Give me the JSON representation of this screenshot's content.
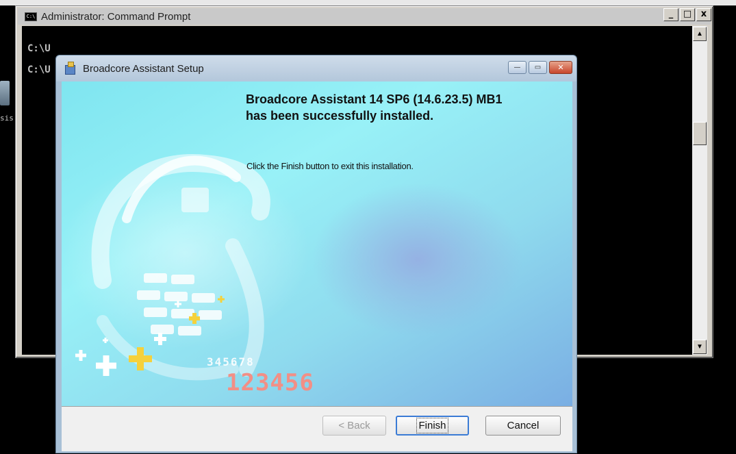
{
  "cmd_window": {
    "title": "Administrator: Command Prompt",
    "icon_text": "C:\\",
    "lines": [
      "C:\\U",
      "C:\\U"
    ],
    "controls": {
      "minimize": "_",
      "maximize": "□",
      "close": "x"
    }
  },
  "desktop": {
    "icon_label": "sis"
  },
  "setup_dialog": {
    "title": "Broadcore Assistant Setup",
    "heading_line1": "Broadcore Assistant 14 SP6 (14.6.23.5) MB1",
    "heading_line2": "has been successfully installed.",
    "instruction": "Click the Finish button to exit this installation.",
    "banner_digits_small": "345678",
    "banner_digits_large": "123456",
    "buttons": {
      "back": "< Back",
      "finish": "Finish",
      "cancel": "Cancel"
    },
    "controls": {
      "minimize": "—",
      "maximize": "▭",
      "close": "✕"
    }
  },
  "colors": {
    "banner_bg": "#8fe6f2",
    "digits_large": "#f28f86",
    "title_bar": "#c3d4e6",
    "close_button": "#c8462b"
  }
}
